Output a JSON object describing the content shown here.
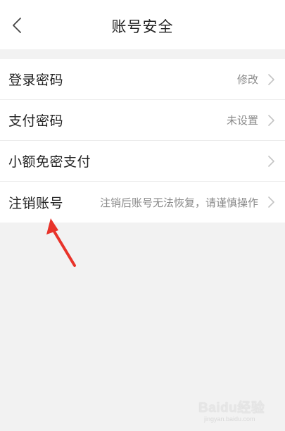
{
  "header": {
    "title": "账号安全",
    "back_icon": "chevron-left-icon"
  },
  "rows": [
    {
      "label": "登录密码",
      "value": "修改"
    },
    {
      "label": "支付密码",
      "value": "未设置"
    },
    {
      "label": "小额免密支付",
      "value": ""
    },
    {
      "label": "注销账号",
      "value": "注销后账号无法恢复，请谨慎操作"
    }
  ],
  "annotation": {
    "arrow_color": "#e8332a"
  },
  "watermark": {
    "brand": "Baidu经验",
    "url": "jingyan.baidu.com"
  },
  "colors": {
    "background": "#f2f2f2",
    "surface": "#ffffff",
    "text": "#222222",
    "secondary_text": "#8a8a8a"
  }
}
